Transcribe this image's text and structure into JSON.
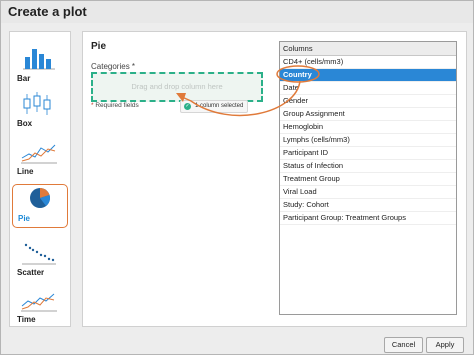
{
  "dialog": {
    "title": "Create a plot"
  },
  "chart_types": [
    {
      "label": "Bar",
      "icon": "bar-chart-icon",
      "selected": false
    },
    {
      "label": "Box",
      "icon": "box-plot-icon",
      "selected": false
    },
    {
      "label": "Line",
      "icon": "line-chart-icon",
      "selected": false
    },
    {
      "label": "Pie",
      "icon": "pie-chart-icon",
      "selected": true
    },
    {
      "label": "Scatter",
      "icon": "scatter-plot-icon",
      "selected": false
    },
    {
      "label": "Time",
      "icon": "time-chart-icon",
      "selected": false
    }
  ],
  "main": {
    "plot_title": "Pie",
    "categories_label": "Categories *",
    "dropzone_placeholder": "Drag and drop column here",
    "required_star": "*",
    "required_text": "Required fields",
    "selected_badge": "1 column selected"
  },
  "columns": {
    "header": "Columns",
    "items": [
      "CD4+ (cells/mm3)",
      "Country",
      "Date",
      "Gender",
      "Group Assignment",
      "Hemoglobin",
      "Lymphs (cells/mm3)",
      "Participant ID",
      "Status of Infection",
      "Treatment Group",
      "Viral Load",
      "Study: Cohort",
      "Participant Group: Treatment Groups"
    ],
    "active_item": "Country"
  },
  "footer": {
    "cancel_label": "Cancel",
    "apply_label": "Apply"
  },
  "colors": {
    "accent": "#2a87d6",
    "highlight": "#e07a3a",
    "dropzone_border": "#2bb089"
  }
}
